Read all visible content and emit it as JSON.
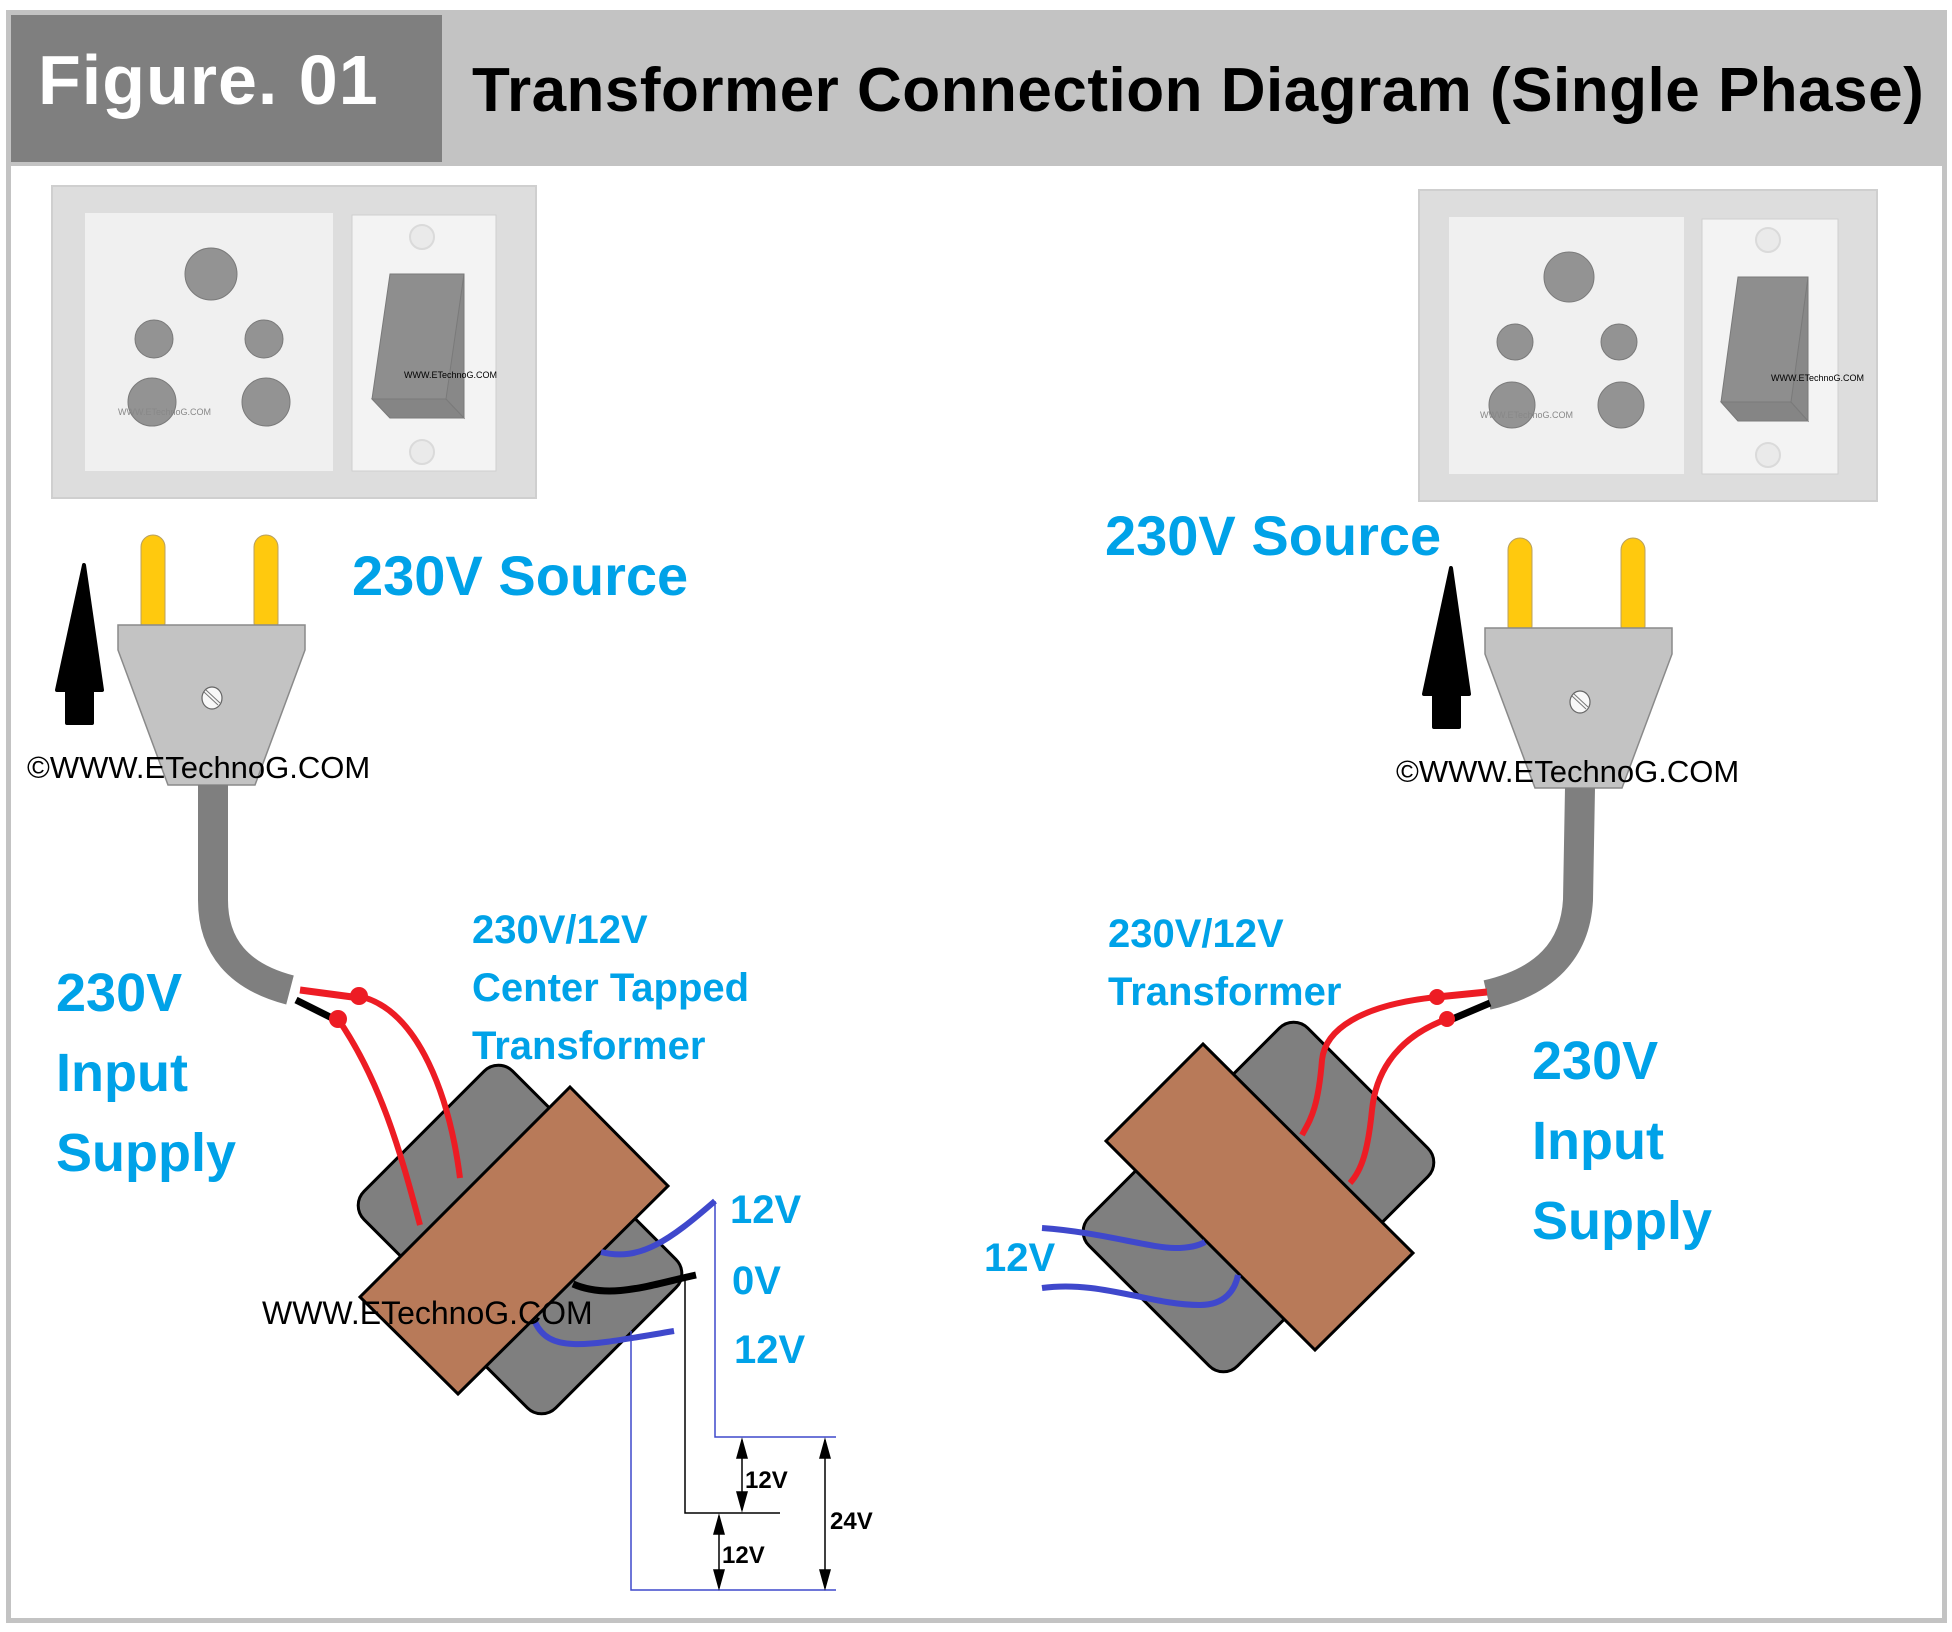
{
  "header": {
    "figure_label": "Figure. 01",
    "title": "Transformer Connection Diagram (Single Phase)"
  },
  "colors": {
    "label_blue": "#00a2e8",
    "core_brown": "#b87a59",
    "coil_gray": "#7f7f7f",
    "primary_wire_red": "#ed1c24",
    "secondary_wire_blue": "#3f48cc",
    "prong_yellow": "#ffc90e",
    "plug_body_gray": "#c3c3c3",
    "header_gray": "#c3c3c3",
    "figure_box_gray": "#7f7f7f"
  },
  "left_diagram": {
    "source_label": "230V Source",
    "watermark_copyright": "©WWW.ETechnoG.COM",
    "input_label": [
      "230V",
      "Input",
      "Supply"
    ],
    "transformer_label": [
      "230V/12V",
      "Center Tapped",
      "Transformer"
    ],
    "secondary_labels": {
      "top": "12V",
      "center": "0V",
      "bottom": "12V"
    },
    "watermark_transformer": "WWW.ETechnoG.COM",
    "outlet_watermark_socket": "WWW.ETechnoG.COM",
    "outlet_watermark_switch": "WWW.ETechnoG.COM",
    "dimension_labels": {
      "upper_half": "12V",
      "lower_half": "12V",
      "total": "24V"
    }
  },
  "right_diagram": {
    "source_label": "230V Source",
    "watermark_copyright": "©WWW.ETechnoG.COM",
    "input_label": [
      "230V",
      "Input",
      "Supply"
    ],
    "transformer_label": [
      "230V/12V",
      "Transformer"
    ],
    "secondary_label": "12V",
    "outlet_watermark_socket": "WWW.ETechnoG.COM",
    "outlet_watermark_switch": "WWW.ETechnoG.COM"
  }
}
